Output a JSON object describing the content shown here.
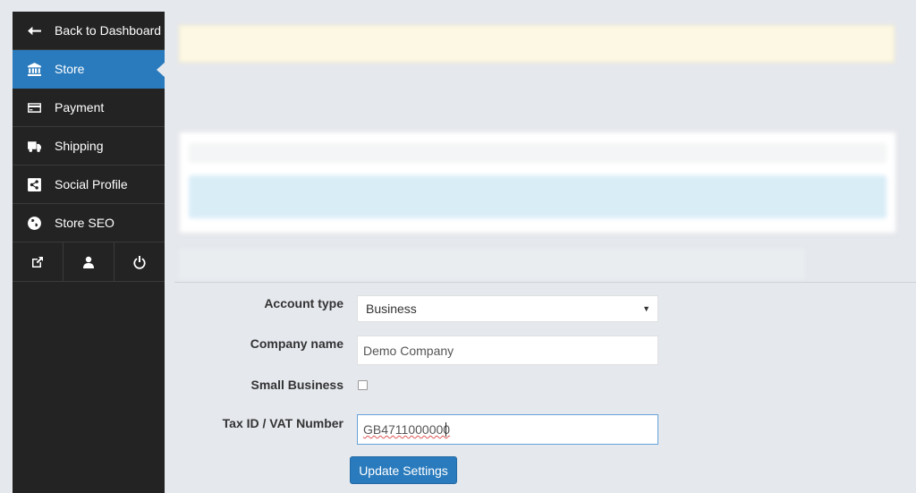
{
  "sidebar": {
    "items": [
      {
        "label": "Back to Dashboard",
        "icon": "arrow-left-icon"
      },
      {
        "label": "Store",
        "icon": "bank-icon",
        "active": true
      },
      {
        "label": "Payment",
        "icon": "credit-card-icon"
      },
      {
        "label": "Shipping",
        "icon": "truck-icon"
      },
      {
        "label": "Social Profile",
        "icon": "share-icon"
      },
      {
        "label": "Store SEO",
        "icon": "globe-icon"
      }
    ],
    "bottom_icons": [
      "external-link-icon",
      "user-icon",
      "power-icon"
    ]
  },
  "colors": {
    "sidebar_bg": "#232323",
    "accent": "#2a7bbd",
    "page_bg": "#e5e8ed"
  },
  "form": {
    "account_type": {
      "label": "Account type",
      "value": "Business"
    },
    "company_name": {
      "label": "Company name",
      "value": "Demo Company"
    },
    "small_business": {
      "label": "Small Business",
      "checked": false
    },
    "tax_id": {
      "label": "Tax ID / VAT Number",
      "value": "GB4711000000"
    },
    "submit_label": "Update Settings"
  }
}
